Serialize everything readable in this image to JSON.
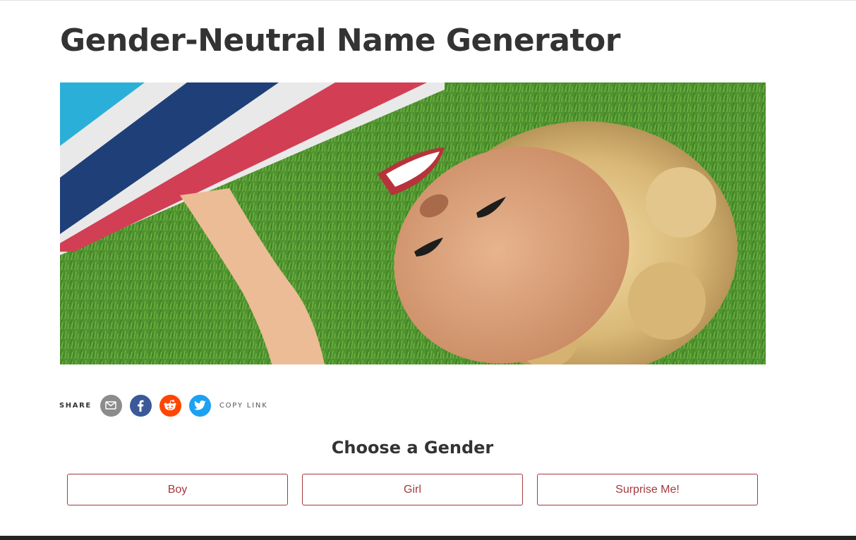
{
  "page": {
    "title": "Gender-Neutral Name Generator"
  },
  "hero_image": {
    "description_icon": "photo-of-smiling-child-icon"
  },
  "share": {
    "label": "SHARE",
    "buttons": [
      {
        "icon": "email-icon",
        "color": "#8c8c8c"
      },
      {
        "icon": "facebook-icon",
        "color": "#3b5998"
      },
      {
        "icon": "reddit-icon",
        "color": "#ff4500"
      },
      {
        "icon": "twitter-icon",
        "color": "#1da1f2"
      }
    ],
    "copy_link_label": "COPY LINK"
  },
  "gender_chooser": {
    "heading": "Choose a Gender",
    "options": [
      "Boy",
      "Girl",
      "Surprise Me!"
    ]
  },
  "colors": {
    "accent": "#a33a3f",
    "text": "#333333"
  }
}
